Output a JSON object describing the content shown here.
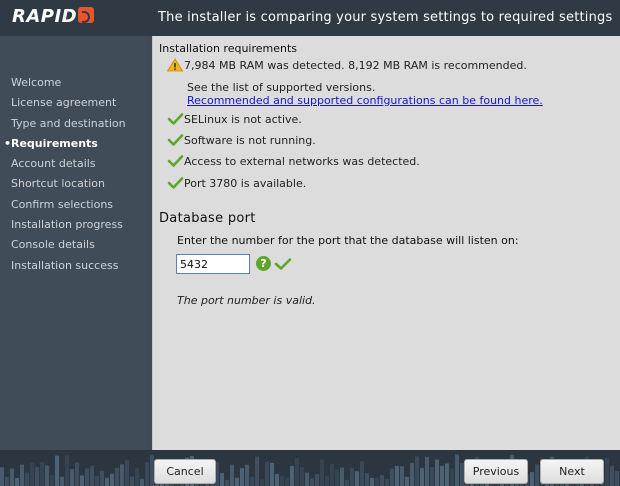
{
  "header": {
    "logo_text": "RAPID",
    "title": "The installer is comparing your system settings to required settings"
  },
  "sidebar": {
    "items": [
      {
        "label": "Welcome",
        "active": false
      },
      {
        "label": "License agreement",
        "active": false
      },
      {
        "label": "Type and destination",
        "active": false
      },
      {
        "label": "Requirements",
        "active": true
      },
      {
        "label": "Account details",
        "active": false
      },
      {
        "label": "Shortcut location",
        "active": false
      },
      {
        "label": "Confirm selections",
        "active": false
      },
      {
        "label": "Installation progress",
        "active": false
      },
      {
        "label": "Console details",
        "active": false
      },
      {
        "label": "Installation success",
        "active": false
      }
    ],
    "active_bullet": "•"
  },
  "requirements": {
    "title": "Installation requirements",
    "ram_warning": "7,984 MB RAM was detected. 8,192 MB RAM is recommended.",
    "ram_sub": "See the list of supported versions.",
    "ram_link": "Recommended and supported configurations can be found here.",
    "selinux": "SELinux is not active.",
    "software": "Software is not running.",
    "network": "Access to external networks was detected.",
    "port": "Port 3780 is available."
  },
  "database": {
    "title": "Database port",
    "prompt": "Enter the number for the port that the database will listen on:",
    "port_value": "5432",
    "help_symbol": "?",
    "valid_message": "The port number is valid."
  },
  "buttons": {
    "cancel": "Cancel",
    "previous": "Previous",
    "next": "Next"
  },
  "colors": {
    "accent": "#e8542b",
    "ok_green": "#5ea62b",
    "warning": "#f2b716",
    "link": "#1515cc"
  }
}
